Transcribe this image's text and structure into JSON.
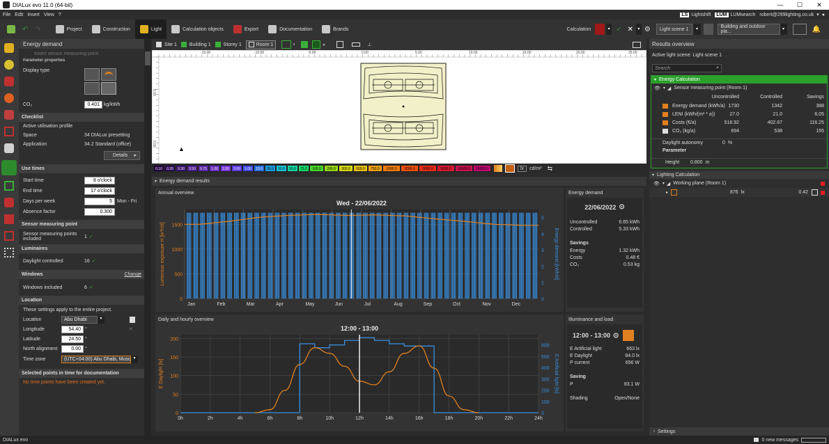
{
  "window": {
    "title": "DIALux evo 11.0  (64-bit)",
    "min": "—",
    "max": "☐",
    "close": "✕"
  },
  "menu": [
    "File",
    "Edit",
    "Insert",
    "View",
    "?"
  ],
  "top_right": {
    "lightshift": "Lightshift",
    "lumsearch": "LUMsearch",
    "account": "robert@299lighting.co.uk"
  },
  "toolbar": {
    "tabs": [
      "Project",
      "Construction",
      "Light",
      "Calculation objects",
      "Export",
      "Documentation",
      "Brands"
    ],
    "active": "Light",
    "calculation": "Calculation",
    "scene": "Light scene 1",
    "view": "Building and outdoor pla..."
  },
  "left_panel": {
    "title": "Energy demand",
    "insert_hint": "Insert sensor measuring point",
    "param_header": "Parameter properties",
    "display_type": "Display type",
    "co2_label": "CO₂",
    "co2_value": "0.401",
    "co2_unit": "kg/kWh",
    "checklist": "Checklist",
    "active_profile": "Active utilisation profile",
    "space_label": "Space",
    "space_value": "34 DIALux presetting",
    "application_label": "Application",
    "application_value": "34.2 Standard (office)",
    "details": "Details",
    "use_times": "Use times",
    "start_label": "Start time",
    "start_value": "8 o'clock",
    "end_label": "End time",
    "end_value": "17 o'clock",
    "days_label": "Days per week",
    "days_value": "5",
    "days_suffix": "Mon - Fri",
    "absence_label": "Absence factor",
    "absence_value": "0.300",
    "sensor_header": "Sensor measuring point",
    "sensor_label": "Sensor measuring points included",
    "sensor_value": "1",
    "luminaires": "Luminaires",
    "daylight_label": "Daylight controlled",
    "daylight_value": "16",
    "windows": "Windows",
    "change": "Change",
    "windows_label": "Windows included",
    "windows_value": "6",
    "location": "Location",
    "location_note": "These settings apply to the entire project.",
    "loc_label": "Location",
    "loc_value": "Abu Dhabi",
    "lon_label": "Longitude",
    "lon_value": "54.40",
    "lat_label": "Latitude",
    "lat_value": "24.50",
    "north_label": "North alignment",
    "north_value": "0.00",
    "deg": "°",
    "tz_label": "Time zone",
    "tz_value": "(UTC+04:00) Abu Dhabi, Musca",
    "selected_header": "Selected points in time for documentation",
    "no_points": "No time points have been created yet."
  },
  "breadcrumb": [
    "Site 1",
    "Building 1",
    "Storey 1",
    "Room 1"
  ],
  "ruler_top": [
    "-15.00",
    "-10.00",
    "-5.00",
    "0.00",
    "5.00",
    "10.00",
    "15.00",
    "20.00",
    "25.00"
  ],
  "ruler_left": [
    "5.00",
    "0.00"
  ],
  "scale": {
    "values": [
      "0.10",
      "0.20",
      "0.30",
      "0.50",
      "0.75",
      "1.00",
      "2.00",
      "3.00",
      "5.00",
      "10.0",
      "20.0",
      "30.0",
      "50.0",
      "75.0",
      "100.0",
      "200.0",
      "300.0",
      "500.0",
      "750.0",
      "1000.0",
      "2000.0",
      "3000.0",
      "5000.0",
      "10000.0",
      "15000.0"
    ],
    "colors": [
      "#240040",
      "#2d0a55",
      "#3a1470",
      "#4b1c8c",
      "#5a26a4",
      "#6a2ebd",
      "#7833d6",
      "#5a3be0",
      "#3c48e0",
      "#2b6ce0",
      "#1c9ce0",
      "#16c4d8",
      "#12d8a4",
      "#18d86a",
      "#4ad82a",
      "#96d818",
      "#d8d812",
      "#e8c010",
      "#f0a010",
      "#f07c10",
      "#f05010",
      "#e82c18",
      "#d81830",
      "#c81050",
      "#c00870"
    ],
    "unit1": "lx",
    "unit2": "cd/m²"
  },
  "results_header": "Energy demand results",
  "annual": {
    "title": "Annual overview",
    "date": "Wed - 22/06/2022",
    "ylabel_left": "Luminous exposure H [lx*h/d]",
    "ylabel_right": "Energy demand [kWh/d]"
  },
  "daily": {
    "title": "Daily and hourly overview",
    "time": "12:00 - 13:00",
    "ylabel_left": "E Daylight [lx]",
    "ylabel_right": "E Artificial light [lx]"
  },
  "energy_demand_panel": {
    "title": "Energy demand",
    "date": "22/06/2022",
    "uncontrolled_label": "Uncontrolled",
    "uncontrolled_value": "6.65 kWh",
    "controlled_label": "Controlled",
    "controlled_value": "5.33 kWh",
    "savings": "Savings",
    "energy_label": "Energy",
    "energy_value": "1.32 kWh",
    "costs_label": "Costs",
    "costs_value": "0.48 €",
    "co2_label": "CO₂",
    "co2_value": "0.53 kg"
  },
  "illum_panel": {
    "title": "Illuminance and load",
    "time": "12:00 - 13:00",
    "eart_label": "E Artificial light",
    "eart_value": "663 lx",
    "eday_label": "E Daylight",
    "eday_value": "84.0 lx",
    "pcur_label": "P current",
    "pcur_value": "656 W",
    "saving": "Saving",
    "p_label": "P",
    "p_value": "83.1 W",
    "shading_label": "Shading",
    "shading_value": "Open/None"
  },
  "results": {
    "title": "Results overview",
    "active_scene": "Active light scene: Light scene 1",
    "search": "Search",
    "energy_calc": "Energy Calculation",
    "sensor_item": "Sensor measuring point (Room 1)",
    "cols": [
      "Uncontrolled",
      "Controlled",
      "Savings"
    ],
    "rows": [
      {
        "label": "Energy demand (kWh/a)",
        "u": "1730",
        "c": "1342",
        "s": "388"
      },
      {
        "label": "LENI (kWh/(m² * a))",
        "u": "27.0",
        "c": "21.0",
        "s": "6.05"
      },
      {
        "label": "Costs (€/a)",
        "u": "518.92",
        "c": "402.67",
        "s": "116.25"
      },
      {
        "label": "CO₂ (kg/a)",
        "u": "694",
        "c": "538",
        "s": "155"
      }
    ],
    "daylight_autonomy": "Daylight autonomy",
    "da_value": "0",
    "da_unit": "%",
    "parameter": "Parameter",
    "height_label": "Height",
    "height_value": "0.800",
    "height_unit": "m",
    "lighting_calc": "Lighting Calculation",
    "working_plane": "Working plane (Room 1)",
    "wp_value": "876",
    "wp_unit": "lx",
    "wp_ratio": "0.42",
    "settings": "Settings"
  },
  "status": {
    "app": "DIALux evo",
    "messages": "0 new messages"
  },
  "chart_data": [
    {
      "type": "bar",
      "title": "Annual overview",
      "subtitle": "Wed - 22/06/2022",
      "ylabel": "Luminous exposure H [lx*h/d]",
      "y2label": "Energy demand [kWh/d]",
      "ylim": [
        0,
        1800
      ],
      "y2lim": [
        0,
        5.5
      ],
      "xticks": [
        "Jan",
        "Feb",
        "Mar",
        "Apr",
        "May",
        "Jun",
        "Jul",
        "Aug",
        "Sep",
        "Oct",
        "Nov",
        "Dec"
      ],
      "yticks": [
        0,
        500,
        1000,
        1500
      ],
      "y2ticks": [
        0,
        1,
        2,
        3,
        4,
        5
      ],
      "bars_note": "daily energy demand bars (weekdays ~5.3 kWh, weekends 0)",
      "weekday_value": 5.3,
      "series": [
        {
          "name": "Luminous exposure",
          "monthly": [
            1500,
            1560,
            1640,
            1680,
            1700,
            1680,
            1690,
            1670,
            1610,
            1560,
            1500,
            1480
          ]
        }
      ]
    },
    {
      "type": "line",
      "title": "Daily and hourly overview",
      "subtitle": "12:00 - 13:00",
      "xticks": [
        "0h",
        "2h",
        "4h",
        "6h",
        "8h",
        "10h",
        "12h",
        "14h",
        "16h",
        "18h",
        "20h",
        "22h",
        "24h"
      ],
      "ylabel": "E Daylight [lx]",
      "y2label": "E Artificial light [lx]",
      "ylim": [
        0,
        210
      ],
      "y2lim": [
        0,
        690
      ],
      "yticks": [
        0,
        50,
        100,
        150,
        200
      ],
      "y2ticks": [
        0,
        100,
        200,
        300,
        400,
        500,
        600
      ],
      "series": [
        {
          "name": "E Daylight",
          "x": [
            5,
            6,
            7,
            8,
            9,
            10,
            11,
            12,
            13,
            14,
            15,
            16,
            17,
            18,
            19,
            20
          ],
          "y": [
            0,
            8,
            60,
            130,
            175,
            160,
            125,
            85,
            75,
            110,
            160,
            180,
            120,
            45,
            8,
            0
          ]
        },
        {
          "name": "E Artificial light",
          "x": [
            0,
            8,
            8,
            9,
            9,
            10,
            10,
            11,
            11,
            12,
            12,
            13,
            13,
            14,
            14,
            15,
            15,
            17,
            17,
            24
          ],
          "y": [
            0,
            0,
            610,
            610,
            575,
            575,
            600,
            600,
            640,
            640,
            665,
            665,
            640,
            640,
            610,
            610,
            590,
            590,
            0,
            0
          ]
        }
      ]
    }
  ]
}
